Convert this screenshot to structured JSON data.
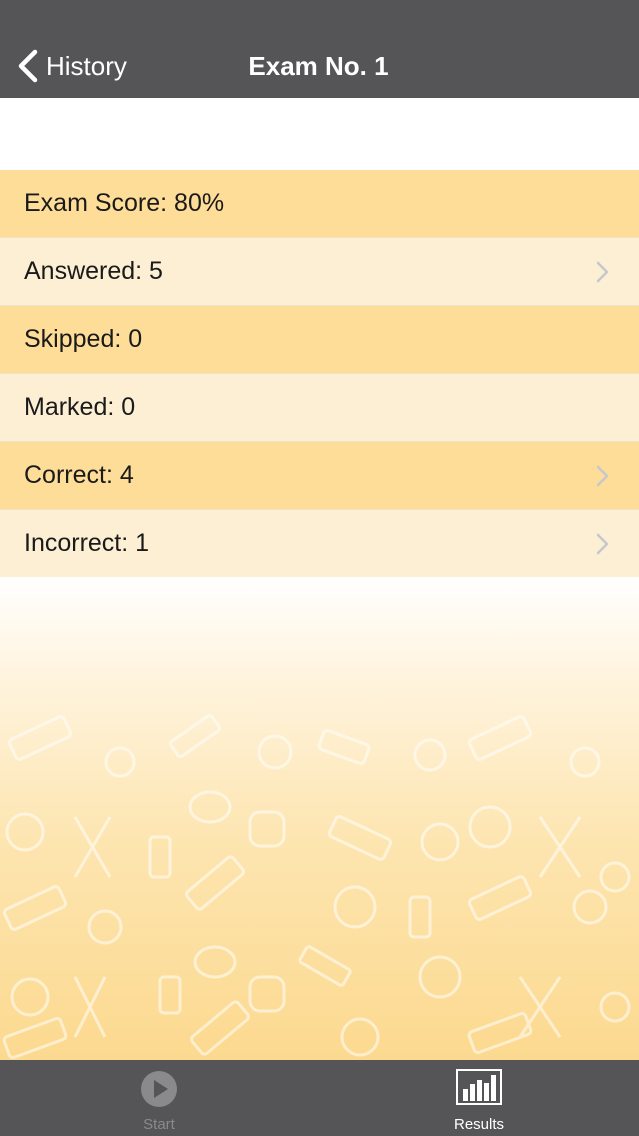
{
  "nav": {
    "back_label": "History",
    "title": "Exam No. 1"
  },
  "results": [
    {
      "label": "Exam Score: 80%",
      "has_chevron": false
    },
    {
      "label": "Answered: 5",
      "has_chevron": true
    },
    {
      "label": "Skipped: 0",
      "has_chevron": false
    },
    {
      "label": "Marked: 0",
      "has_chevron": false
    },
    {
      "label": "Correct: 4",
      "has_chevron": true
    },
    {
      "label": "Incorrect: 1",
      "has_chevron": true
    }
  ],
  "tabs": [
    {
      "label": "Start",
      "icon": "play-icon",
      "selected": false
    },
    {
      "label": "Results",
      "icon": "bar-chart-icon",
      "selected": true
    }
  ],
  "colors": {
    "bar": "#555457",
    "row_dark": "#fddd98",
    "row_light": "#fdefd4",
    "chevron": "#c7c7cc"
  }
}
